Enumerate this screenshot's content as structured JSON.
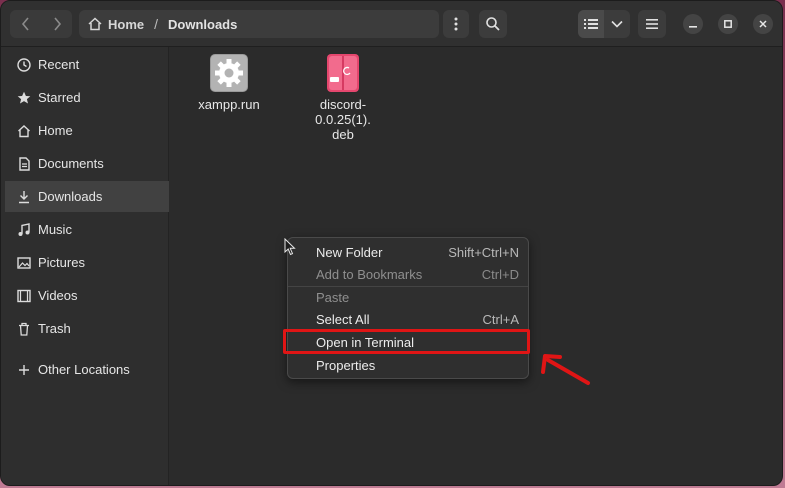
{
  "header": {
    "breadcrumb": [
      "Home",
      "Downloads"
    ],
    "separator": "/"
  },
  "sidebar": {
    "items": [
      {
        "label": "Recent",
        "icon": "clock-icon"
      },
      {
        "label": "Starred",
        "icon": "star-icon"
      },
      {
        "label": "Home",
        "icon": "home-icon"
      },
      {
        "label": "Documents",
        "icon": "document-icon"
      },
      {
        "label": "Downloads",
        "icon": "download-icon",
        "active": true
      },
      {
        "label": "Music",
        "icon": "music-icon"
      },
      {
        "label": "Pictures",
        "icon": "picture-icon"
      },
      {
        "label": "Videos",
        "icon": "video-icon"
      },
      {
        "label": "Trash",
        "icon": "trash-icon"
      },
      {
        "label": "Other Locations",
        "icon": "plus-icon"
      }
    ]
  },
  "files": [
    {
      "name": "xampp.run",
      "icon": "executable-gear-icon"
    },
    {
      "name_lines": [
        "discord-",
        "0.0.25(1).",
        "deb"
      ],
      "icon": "debian-package-icon"
    }
  ],
  "context_menu": {
    "items": [
      {
        "label": "New Folder",
        "shortcut": "Shift+Ctrl+N",
        "enabled": true
      },
      {
        "label": "Add to Bookmarks",
        "shortcut": "Ctrl+D",
        "enabled": false
      },
      {
        "label": "Paste",
        "shortcut": "",
        "enabled": false
      },
      {
        "label": "Select All",
        "shortcut": "Ctrl+A",
        "enabled": true
      },
      {
        "label": "Open in Terminal",
        "shortcut": "",
        "enabled": true,
        "highlighted": true
      },
      {
        "label": "Properties",
        "shortcut": "",
        "enabled": true
      }
    ]
  },
  "colors": {
    "annotation": "#e01515",
    "window_bg": "#2b2b2b",
    "sidebar_active": "#414141"
  }
}
